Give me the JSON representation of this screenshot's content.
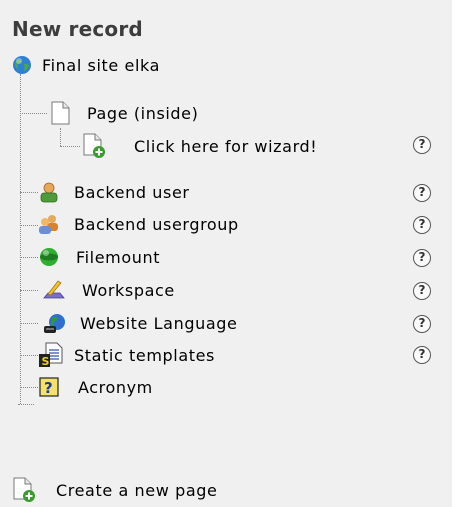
{
  "panel": {
    "title": "New record",
    "root": {
      "label": "Final site elka",
      "icon": "globe-icon"
    },
    "page_group": {
      "label": "Page (inside)",
      "icon": "page-icon",
      "wizard": {
        "label": "Click here for wizard!",
        "icon": "new-page-icon"
      }
    },
    "items": [
      {
        "label": "Backend user",
        "icon": "user-icon"
      },
      {
        "label": "Backend usergroup",
        "icon": "usergroup-icon"
      },
      {
        "label": "Filemount",
        "icon": "filemount-icon"
      },
      {
        "label": "Workspace",
        "icon": "workspace-icon"
      },
      {
        "label": "Website Language",
        "icon": "language-icon"
      },
      {
        "label": "Static templates",
        "icon": "static-templates-icon"
      },
      {
        "label": "Acronym",
        "icon": "acronym-icon"
      }
    ],
    "help_symbol": "?",
    "create_page": {
      "label": "Create a new page",
      "icon": "new-page-icon"
    }
  }
}
